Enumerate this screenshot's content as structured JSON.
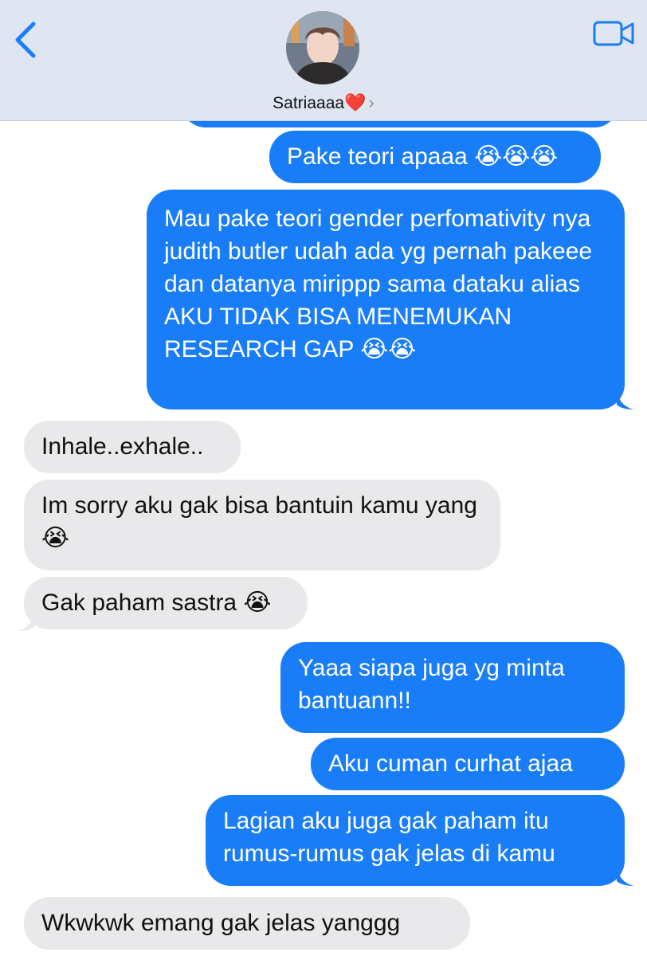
{
  "header": {
    "contact_name": "Satriaaaa",
    "heart": "❤️",
    "chevron": "›",
    "back_icon": "chevron-left-icon",
    "video_icon": "video-camera-icon",
    "accent": "#1a7df8"
  },
  "messages": [
    {
      "dir": "out",
      "text": "Pake teori apaaa 😭😭😭"
    },
    {
      "dir": "out",
      "text": "Mau pake teori gender perfomativity nya judith butler udah ada yg pernah pakeee dan datanya mirippp sama dataku alias AKU TIDAK BISA MENEMUKAN RESEARCH GAP 😭😭"
    },
    {
      "dir": "in",
      "text": "Inhale..exhale.."
    },
    {
      "dir": "in",
      "text": "Im sorry aku gak bisa bantuin kamu yang 😭"
    },
    {
      "dir": "in",
      "text": "Gak paham sastra 😭"
    },
    {
      "dir": "out",
      "text": "Yaaa siapa juga yg minta bantuann!!"
    },
    {
      "dir": "out",
      "text": "Aku cuman curhat ajaa"
    },
    {
      "dir": "out",
      "text": "Lagian aku juga gak paham itu rumus-rumus gak jelas di kamu"
    },
    {
      "dir": "in",
      "text": "Wkwkwk emang gak jelas yanggg"
    }
  ],
  "colors": {
    "outgoing": "#1a7df8",
    "incoming": "#e9e9eb",
    "header_bg": "#dfe6f2"
  }
}
